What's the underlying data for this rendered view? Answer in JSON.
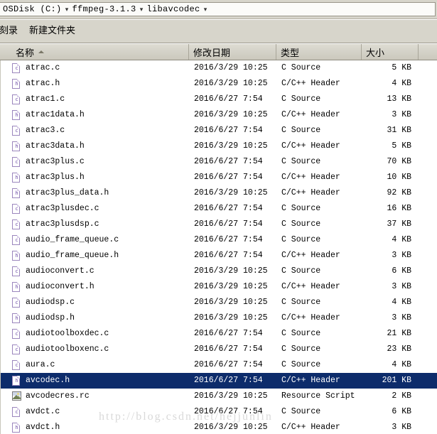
{
  "address_bar": {
    "crumbs": [
      "OSDisk (C:)",
      "ffmpeg-3.1.3",
      "libavcodec"
    ],
    "separator": "▾"
  },
  "toolbar": {
    "items": [
      "刻录",
      "新建文件夹"
    ]
  },
  "columns": [
    {
      "label": "名称",
      "sorted": "asc"
    },
    {
      "label": "修改日期",
      "sorted": ""
    },
    {
      "label": "类型",
      "sorted": ""
    },
    {
      "label": "大小",
      "sorted": ""
    }
  ],
  "files": [
    {
      "name": "atrac.c",
      "icon": "c-source-icon",
      "letter": "c",
      "date": "2016/3/29 10:25",
      "type": "C Source",
      "size": "5 KB",
      "selected": false
    },
    {
      "name": "atrac.h",
      "icon": "c-header-icon",
      "letter": "h",
      "date": "2016/3/29 10:25",
      "type": "C/C++ Header",
      "size": "4 KB",
      "selected": false
    },
    {
      "name": "atrac1.c",
      "icon": "c-source-icon",
      "letter": "c",
      "date": "2016/6/27 7:54",
      "type": "C Source",
      "size": "13 KB",
      "selected": false
    },
    {
      "name": "atrac1data.h",
      "icon": "c-header-icon",
      "letter": "h",
      "date": "2016/3/29 10:25",
      "type": "C/C++ Header",
      "size": "3 KB",
      "selected": false
    },
    {
      "name": "atrac3.c",
      "icon": "c-source-icon",
      "letter": "c",
      "date": "2016/6/27 7:54",
      "type": "C Source",
      "size": "31 KB",
      "selected": false
    },
    {
      "name": "atrac3data.h",
      "icon": "c-header-icon",
      "letter": "h",
      "date": "2016/3/29 10:25",
      "type": "C/C++ Header",
      "size": "5 KB",
      "selected": false
    },
    {
      "name": "atrac3plus.c",
      "icon": "c-source-icon",
      "letter": "c",
      "date": "2016/6/27 7:54",
      "type": "C Source",
      "size": "70 KB",
      "selected": false
    },
    {
      "name": "atrac3plus.h",
      "icon": "c-header-icon",
      "letter": "h",
      "date": "2016/6/27 7:54",
      "type": "C/C++ Header",
      "size": "10 KB",
      "selected": false
    },
    {
      "name": "atrac3plus_data.h",
      "icon": "c-header-icon",
      "letter": "h",
      "date": "2016/3/29 10:25",
      "type": "C/C++ Header",
      "size": "92 KB",
      "selected": false
    },
    {
      "name": "atrac3plusdec.c",
      "icon": "c-source-icon",
      "letter": "c",
      "date": "2016/6/27 7:54",
      "type": "C Source",
      "size": "16 KB",
      "selected": false
    },
    {
      "name": "atrac3plusdsp.c",
      "icon": "c-source-icon",
      "letter": "c",
      "date": "2016/6/27 7:54",
      "type": "C Source",
      "size": "37 KB",
      "selected": false
    },
    {
      "name": "audio_frame_queue.c",
      "icon": "c-source-icon",
      "letter": "c",
      "date": "2016/6/27 7:54",
      "type": "C Source",
      "size": "4 KB",
      "selected": false
    },
    {
      "name": "audio_frame_queue.h",
      "icon": "c-header-icon",
      "letter": "h",
      "date": "2016/6/27 7:54",
      "type": "C/C++ Header",
      "size": "3 KB",
      "selected": false
    },
    {
      "name": "audioconvert.c",
      "icon": "c-source-icon",
      "letter": "c",
      "date": "2016/3/29 10:25",
      "type": "C Source",
      "size": "6 KB",
      "selected": false
    },
    {
      "name": "audioconvert.h",
      "icon": "c-header-icon",
      "letter": "h",
      "date": "2016/3/29 10:25",
      "type": "C/C++ Header",
      "size": "3 KB",
      "selected": false
    },
    {
      "name": "audiodsp.c",
      "icon": "c-source-icon",
      "letter": "c",
      "date": "2016/3/29 10:25",
      "type": "C Source",
      "size": "4 KB",
      "selected": false
    },
    {
      "name": "audiodsp.h",
      "icon": "c-header-icon",
      "letter": "h",
      "date": "2016/3/29 10:25",
      "type": "C/C++ Header",
      "size": "3 KB",
      "selected": false
    },
    {
      "name": "audiotoolboxdec.c",
      "icon": "c-source-icon",
      "letter": "c",
      "date": "2016/6/27 7:54",
      "type": "C Source",
      "size": "21 KB",
      "selected": false
    },
    {
      "name": "audiotoolboxenc.c",
      "icon": "c-source-icon",
      "letter": "c",
      "date": "2016/6/27 7:54",
      "type": "C Source",
      "size": "23 KB",
      "selected": false
    },
    {
      "name": "aura.c",
      "icon": "c-source-icon",
      "letter": "c",
      "date": "2016/6/27 7:54",
      "type": "C Source",
      "size": "4 KB",
      "selected": false
    },
    {
      "name": "avcodec.h",
      "icon": "c-header-icon",
      "letter": "h",
      "date": "2016/6/27 7:54",
      "type": "C/C++ Header",
      "size": "201 KB",
      "selected": true
    },
    {
      "name": "avcodecres.rc",
      "icon": "resource-script-icon",
      "letter": "",
      "date": "2016/3/29 10:25",
      "type": "Resource Script",
      "size": "2 KB",
      "selected": false
    },
    {
      "name": "avdct.c",
      "icon": "c-source-icon",
      "letter": "c",
      "date": "2016/6/27 7:54",
      "type": "C Source",
      "size": "6 KB",
      "selected": false
    },
    {
      "name": "avdct.h",
      "icon": "c-header-icon",
      "letter": "h",
      "date": "2016/3/29 10:25",
      "type": "C/C++ Header",
      "size": "3 KB",
      "selected": false
    }
  ],
  "watermark": {
    "text": "http://blog.csdn.net/hejjunlin"
  },
  "colors": {
    "selection": "#0d2c6b",
    "chrome": "#d7d5cb",
    "header": "#d3d1c7",
    "icon_purple": "#9b86bd",
    "watermark": "#d9d9d9"
  }
}
